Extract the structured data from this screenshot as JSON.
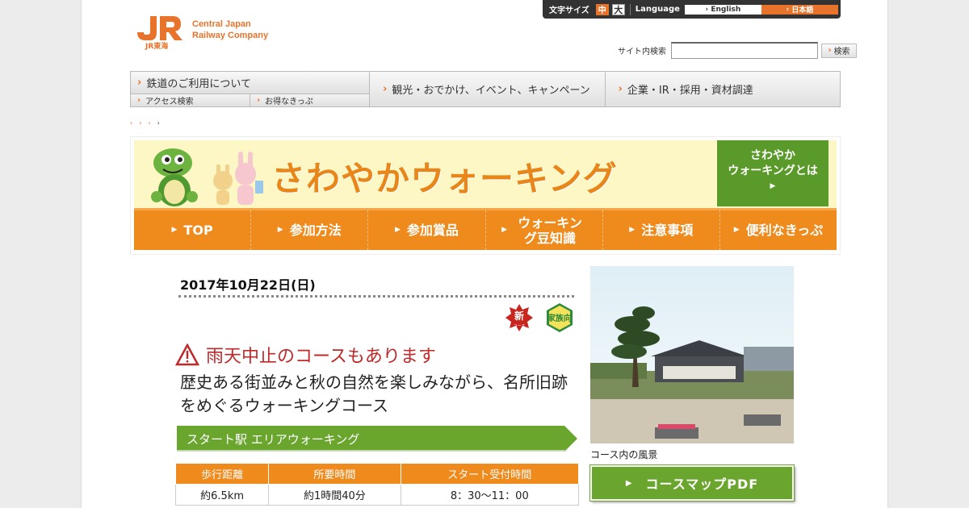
{
  "header": {
    "logo_mark": "JR東海",
    "logo_line1": "Central Japan",
    "logo_line2": "Railway Company",
    "font_size_label": "文字サイズ",
    "font_mid": "中",
    "font_big": "大",
    "language_label": "Language",
    "lang_english": "English",
    "lang_japanese": "日本語",
    "search_label": "サイト内検索",
    "search_value": "",
    "search_button": "検索"
  },
  "gnav": {
    "item1": "鉄道のご利用について",
    "sub1": "アクセス検索",
    "sub2": "お得なきっぷ",
    "item2": "観光・おでかけ、イベント、キャンペーン",
    "item3": "企業・IR・採用・資材調達"
  },
  "banner": {
    "title": "さわやかウォーキング",
    "about_line1": "さわやか",
    "about_line2": "ウォーキングとは",
    "nav": [
      "TOP",
      "参加方法",
      "参加賞品",
      "ウォーキング豆知識",
      "注意事項",
      "便利なきっぷ"
    ]
  },
  "event": {
    "date": "2017年10月22日(日)",
    "badge_new": "新",
    "badge_new_sub": "コース",
    "badge_family": "家族向",
    "warning": "雨天中止のコースもあります",
    "headline": "歴史ある街並みと秋の自然を楽しみながら、名所旧跡をめぐるウォーキングコース",
    "course_title": "スタート駅 エリアウォーキング",
    "table_headers": [
      "歩行距離",
      "所要時間",
      "スタート受付時間"
    ],
    "table_values": [
      "約6.5km",
      "約1時間40分",
      "8：30〜11：00"
    ],
    "photo_caption": "コース内の風景",
    "map_button": "コースマップPDF"
  },
  "colors": {
    "brand_orange": "#e8732a",
    "nav_orange": "#ef8a1c",
    "accent_green": "#5a9a2a",
    "warning_red": "#c0282a"
  }
}
